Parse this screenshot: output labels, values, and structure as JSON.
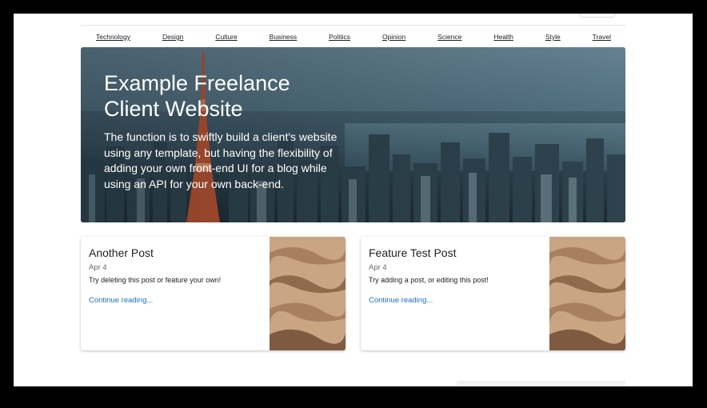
{
  "nav": {
    "items": [
      "Technology",
      "Design",
      "Culture",
      "Business",
      "Politics",
      "Opinion",
      "Science",
      "Health",
      "Style",
      "Travel"
    ]
  },
  "hero": {
    "title": "Example Freelance Client Website",
    "description": "The function is to swiftly build a client's website using any template, but having the flexibility of adding your own front-end UI for a blog while using an API for your own back-end."
  },
  "posts": [
    {
      "title": "Another Post",
      "date": "Apr 4",
      "excerpt": "Try deleting this post or feature your own!",
      "link": "Continue reading..."
    },
    {
      "title": "Feature Test Post",
      "date": "Apr 4",
      "excerpt": "Try adding a post, or editing this post!",
      "link": "Continue reading..."
    }
  ],
  "colors": {
    "link": "#1e6fc7",
    "text": "#222222",
    "frame": "#000000"
  }
}
